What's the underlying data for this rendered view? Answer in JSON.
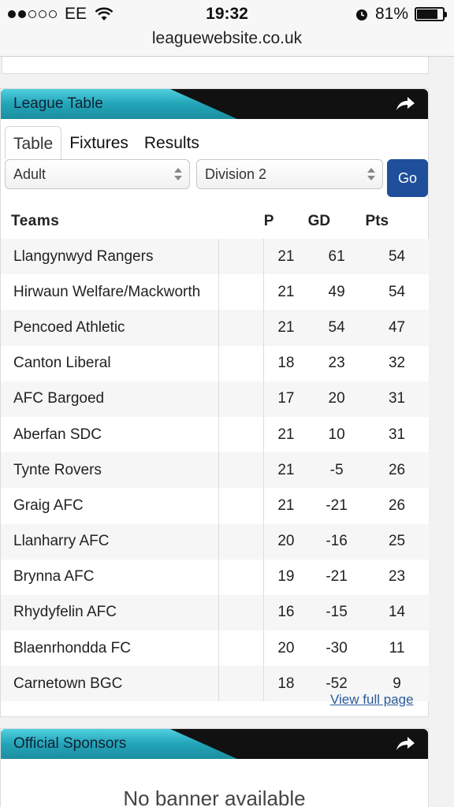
{
  "status_bar": {
    "carrier": "EE",
    "time": "19:32",
    "battery": "81%",
    "battery_level": 0.81
  },
  "url": "leaguewebsite.co.uk",
  "league_widget": {
    "title": "League Table",
    "tabs": [
      {
        "label": "Table",
        "active": true
      },
      {
        "label": "Fixtures",
        "active": false
      },
      {
        "label": "Results",
        "active": false
      }
    ],
    "age_select": "Adult",
    "division_select": "Division 2",
    "go_label": "Go",
    "columns": {
      "team": "Teams",
      "p": "P",
      "gd": "GD",
      "pts": "Pts"
    },
    "rows": [
      {
        "team": "Llangynwyd Rangers",
        "p": "21",
        "gd": "61",
        "pts": "54"
      },
      {
        "team": "Hirwaun Welfare/Mackworth",
        "p": "21",
        "gd": "49",
        "pts": "54"
      },
      {
        "team": "Pencoed Athletic",
        "p": "21",
        "gd": "54",
        "pts": "47"
      },
      {
        "team": "Canton Liberal",
        "p": "18",
        "gd": "23",
        "pts": "32"
      },
      {
        "team": "AFC Bargoed",
        "p": "17",
        "gd": "20",
        "pts": "31"
      },
      {
        "team": "Aberfan SDC",
        "p": "21",
        "gd": "10",
        "pts": "31"
      },
      {
        "team": "Tynte Rovers",
        "p": "21",
        "gd": "-5",
        "pts": "26"
      },
      {
        "team": "Graig AFC",
        "p": "21",
        "gd": "-21",
        "pts": "26"
      },
      {
        "team": "Llanharry AFC",
        "p": "20",
        "gd": "-16",
        "pts": "25"
      },
      {
        "team": "Brynna AFC",
        "p": "19",
        "gd": "-21",
        "pts": "23"
      },
      {
        "team": "Rhydyfelin AFC",
        "p": "16",
        "gd": "-15",
        "pts": "14"
      },
      {
        "team": "Blaenrhondda FC",
        "p": "20",
        "gd": "-30",
        "pts": "11"
      },
      {
        "team": "Carnetown BGC",
        "p": "18",
        "gd": "-52",
        "pts": "9"
      }
    ],
    "view_full_label": "View full page"
  },
  "sponsors_widget": {
    "title": "Official Sponsors",
    "message": "No banner available"
  },
  "colors": {
    "header_teal": "#23a4b8",
    "header_dark": "#111111",
    "go_button": "#1f4f9a",
    "link": "#2a5a9a"
  }
}
